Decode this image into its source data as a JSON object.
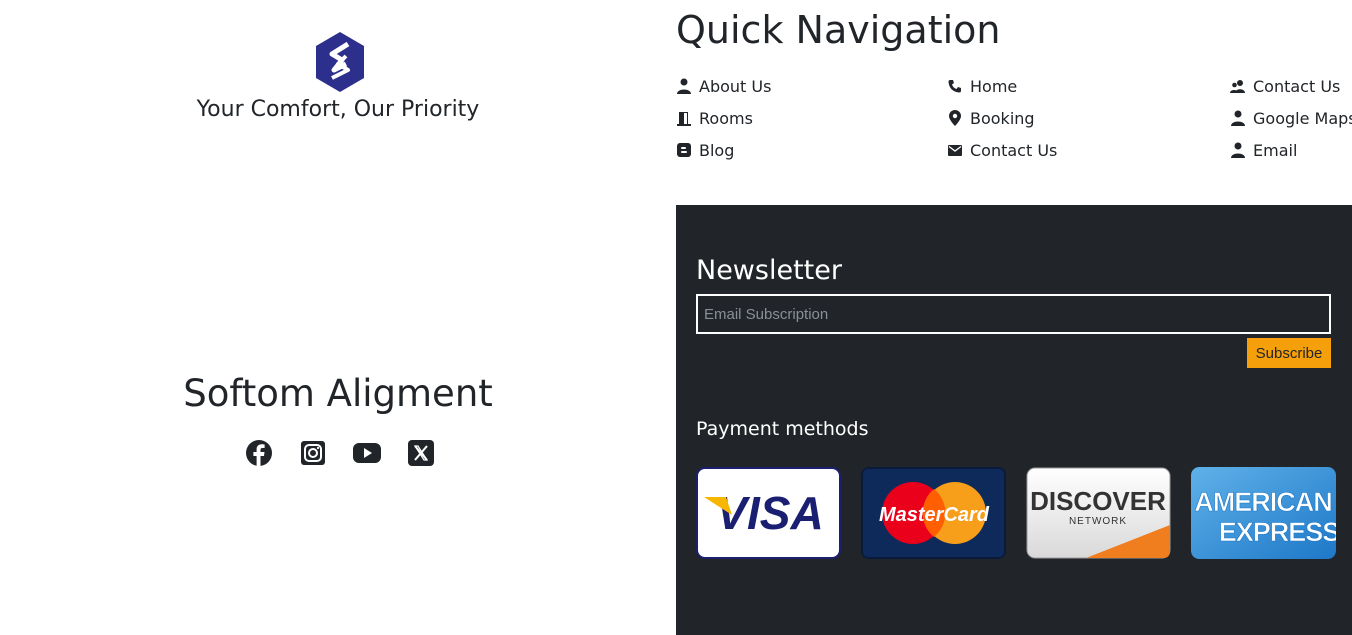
{
  "brand": {
    "tagline": "Your Comfort, Our Priority",
    "name": "Softom Aligment"
  },
  "social": [
    "facebook-icon",
    "instagram-icon",
    "youtube-icon",
    "x-icon"
  ],
  "quick_nav": {
    "title": "Quick Navigation",
    "columns": [
      [
        {
          "label": "About Us",
          "icon": "person-icon"
        },
        {
          "label": "Rooms",
          "icon": "door-icon"
        },
        {
          "label": "Blog",
          "icon": "blogger-icon"
        }
      ],
      [
        {
          "label": "Home",
          "icon": "phone-icon"
        },
        {
          "label": "Booking",
          "icon": "map-pin-icon"
        },
        {
          "label": "Contact Us",
          "icon": "envelope-icon"
        }
      ],
      [
        {
          "label": "Contact Us",
          "icon": "people-icon"
        },
        {
          "label": "Google Maps",
          "icon": "person-icon"
        },
        {
          "label": "Email",
          "icon": "person-icon"
        }
      ]
    ]
  },
  "newsletter": {
    "title": "Newsletter",
    "placeholder": "Email Subscription",
    "button": "Subscribe"
  },
  "payment": {
    "title": "Payment methods",
    "cards": [
      {
        "name": "visa-card",
        "text": "VISA"
      },
      {
        "name": "mastercard-card",
        "text": "MasterCard"
      },
      {
        "name": "discover-card",
        "text": "DISCOVER",
        "sub": "NETWORK"
      },
      {
        "name": "amex-card",
        "text": "AMERICAN",
        "text2": "EXPRESS"
      }
    ]
  },
  "colors": {
    "dark_panel": "#212529",
    "subscribe": "#f5a00b",
    "text": "#212529"
  }
}
